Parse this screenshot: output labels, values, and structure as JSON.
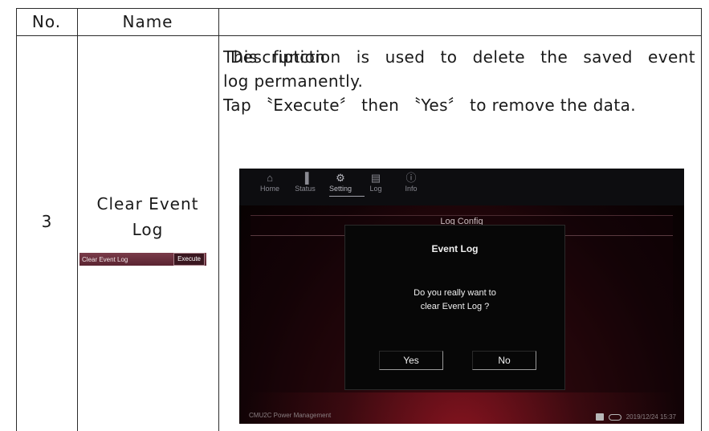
{
  "table": {
    "headers": {
      "no": "No.",
      "name": "Name",
      "description": "Description"
    },
    "row": {
      "no": "3",
      "name_line1": "Clear Event",
      "name_line2": "Log",
      "mini_label": "Clear Event Log",
      "mini_button": "Execute",
      "desc_line1": "This function is used to delete the saved event",
      "desc_line2": "log permanently.",
      "desc_line3": "Tap 〝Execute〞 then 〝Yes〞 to remove the data."
    }
  },
  "screenshot": {
    "nav": [
      {
        "label": "Home",
        "icon": "⌂"
      },
      {
        "label": "Status",
        "icon": "▐"
      },
      {
        "label": "Setting",
        "icon": "⚙"
      },
      {
        "label": "Log",
        "icon": "▤"
      },
      {
        "label": "Info",
        "icon": "ⓘ"
      }
    ],
    "panel_title": "Log Config",
    "dialog": {
      "title": "Event Log",
      "message_line1": "Do you really want to",
      "message_line2": "clear Event Log ?",
      "yes": "Yes",
      "no": "No"
    },
    "footer_left": "CMU2C Power Management",
    "footer_datetime": "2019/12/24 15:37",
    "footer_icons": [
      "sd-card-icon",
      "link-icon"
    ]
  }
}
